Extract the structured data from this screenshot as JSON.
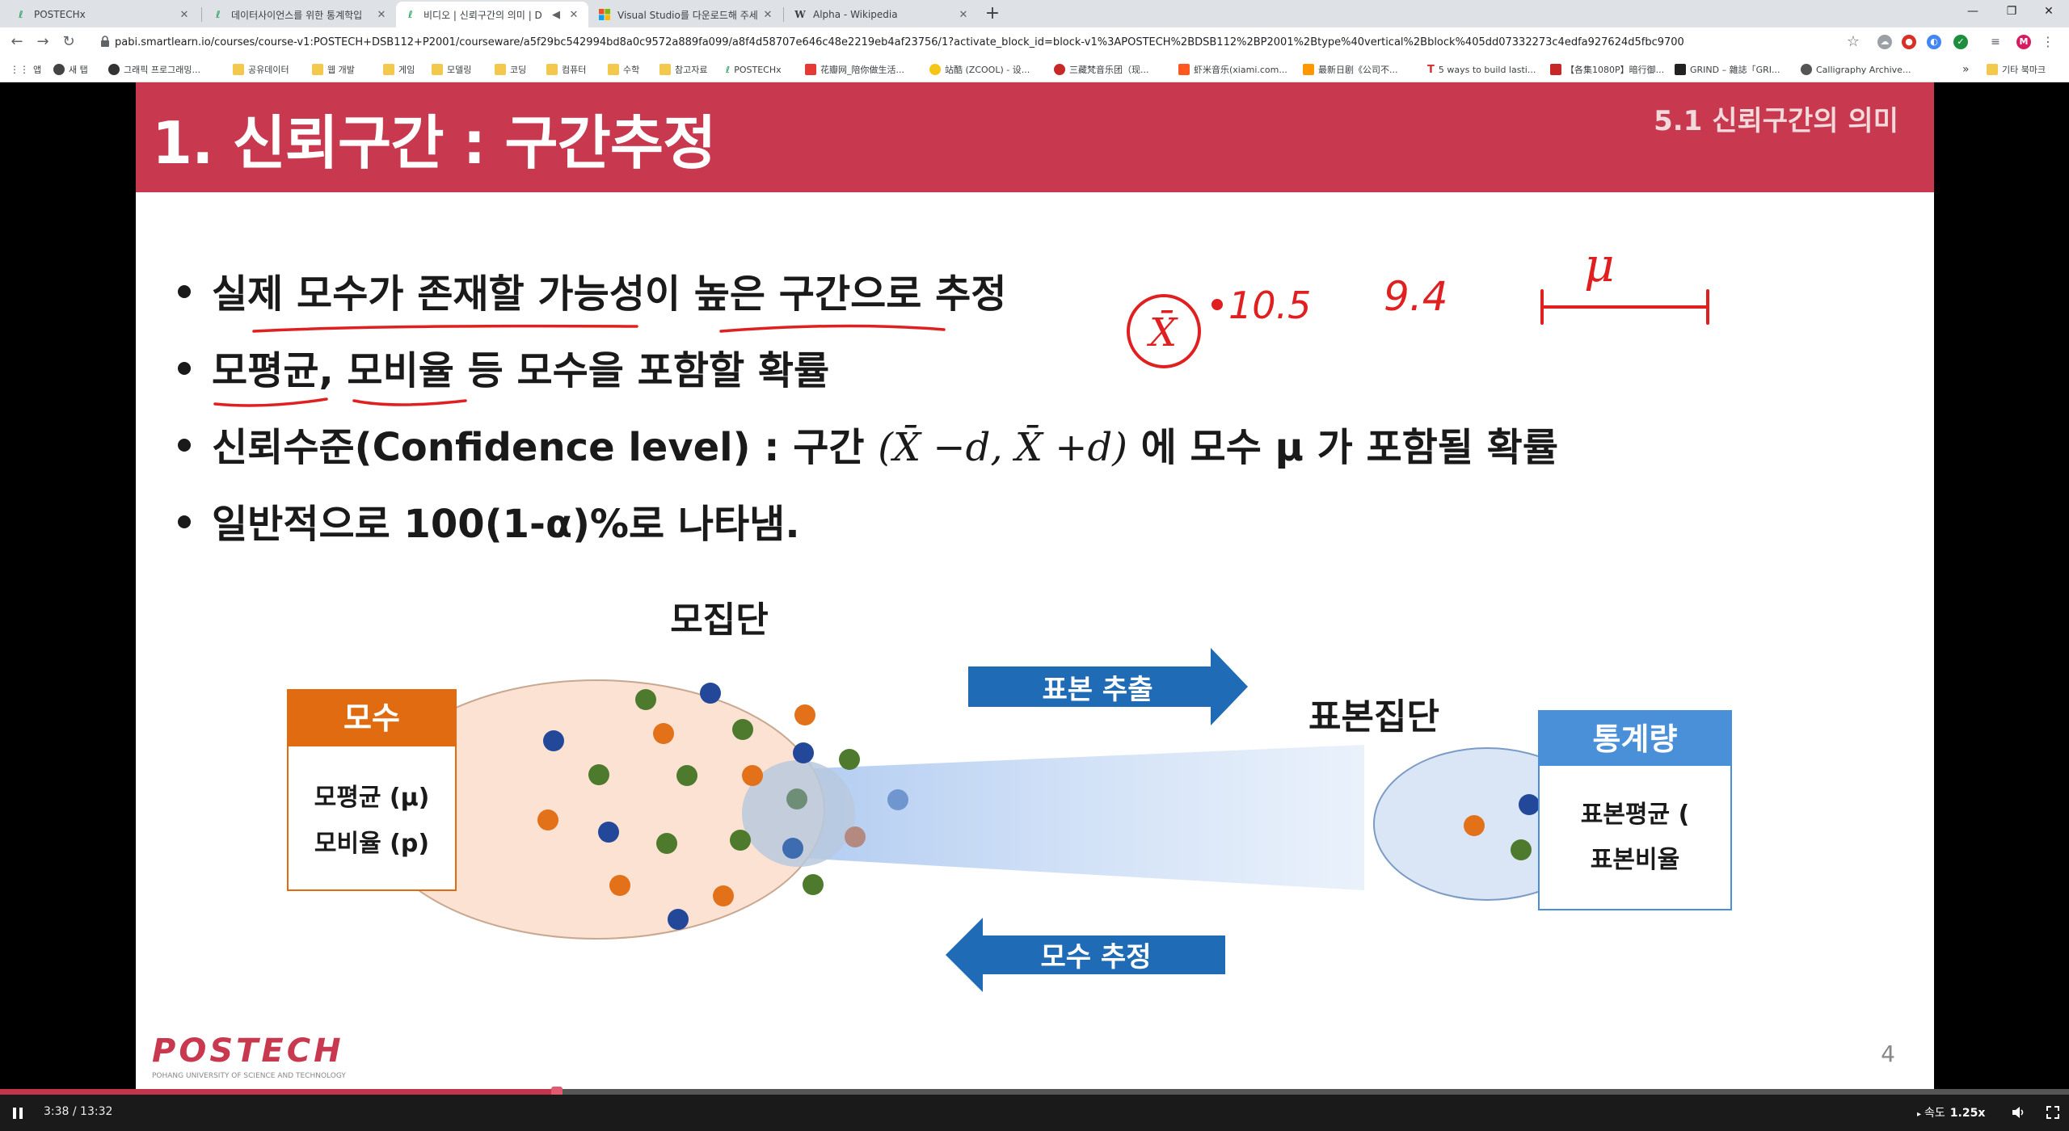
{
  "browser": {
    "tabs": [
      {
        "title": "POSTECHx",
        "icon": "edx-icon",
        "active": false
      },
      {
        "title": "데이터사이언스를 위한 통계학입",
        "icon": "edx-icon",
        "active": false
      },
      {
        "title": "비디오 | 신뢰구간의 의미 | D",
        "icon": "edx-icon",
        "active": true
      },
      {
        "title": "Visual Studio를 다운로드해 주세",
        "icon": "microsoft-icon",
        "active": false
      },
      {
        "title": "Alpha - Wikipedia",
        "icon": "wikipedia-icon",
        "active": false
      }
    ],
    "url": "pabi.smartlearn.io/courses/course-v1:POSTECH+DSB112+P2001/courseware/a5f29bc542994bd8a0c9572a889fa099/a8f4d58707e646c48e2219eb4af23756/1?activate_block_id=block-v1%3APOSTECH%2BDSB112%2BP2001%2Btype%40vertical%2Bblock%405dd07332273c4edfa927624d5fbc9700",
    "profile_initial": "M",
    "bookmarks": [
      {
        "label": "앱",
        "type": "apps"
      },
      {
        "label": "새 탭",
        "type": "site"
      },
      {
        "label": "그래픽 프로그래밍...",
        "type": "site"
      },
      {
        "label": "공유데이터",
        "type": "folder"
      },
      {
        "label": "웹 개발",
        "type": "folder"
      },
      {
        "label": "게임",
        "type": "folder"
      },
      {
        "label": "모델링",
        "type": "folder"
      },
      {
        "label": "코딩",
        "type": "folder"
      },
      {
        "label": "컴퓨터",
        "type": "folder"
      },
      {
        "label": "수학",
        "type": "folder"
      },
      {
        "label": "참고자료",
        "type": "folder"
      },
      {
        "label": "POSTECHx",
        "type": "site"
      },
      {
        "label": "花瓣网_陪你做生活...",
        "type": "site"
      },
      {
        "label": "站酷 (ZCOOL) - 设...",
        "type": "site"
      },
      {
        "label": "三藏梵音乐团（现...",
        "type": "site"
      },
      {
        "label": "虾米音乐(xiami.com...",
        "type": "site"
      },
      {
        "label": "最新日剧《公司不...",
        "type": "site"
      },
      {
        "label": "5 ways to build lasti...",
        "type": "site"
      },
      {
        "label": "【各集1080P】暗行御...",
        "type": "site"
      },
      {
        "label": "GRIND – 雜誌「GRI...",
        "type": "site"
      },
      {
        "label": "Calligraphy Archive...",
        "type": "site"
      },
      {
        "label": "»",
        "type": "more"
      },
      {
        "label": "기타 북마크",
        "type": "folder"
      }
    ]
  },
  "slide": {
    "title": "1. 신뢰구간 : 구간추정",
    "section": "5.1 신뢰구간의 의미",
    "bullets": [
      "실제 모수가 존재할 가능성이 높은 구간으로 추정",
      "모평균, 모비율 등 모수을 포함할 확률",
      "신뢰수준(Confidence level) : 구간",
      "일반적으로 100(1-α)%로 나타냄."
    ],
    "bullet3_formula": "(X̄ −d, X̄ +d)",
    "bullet3_suffix": "에 모수 μ 가 포함될 확률",
    "annotations": {
      "circled": "X̄",
      "v1": "10.5",
      "v2": "9.4",
      "mu": "μ"
    },
    "population_label": "모집단",
    "sample_label": "표본집단",
    "arrow_sampling": "표본 추출",
    "arrow_estimation": "모수 추정",
    "parameter_box": {
      "header": "모수",
      "line1": "모평균 (μ)",
      "line2": "모비율 (p)"
    },
    "statistic_box": {
      "header": "통계량",
      "line1": "표본평균 (",
      "line2": "표본비율"
    },
    "logo": "POSTECH",
    "logo_sub": "POHANG UNIVERSITY OF SCIENCE AND TECHNOLOGY",
    "page_number": "4",
    "colors": {
      "header": "#c8384e",
      "parameter": "#e06b10",
      "statistic": "#4a90d9",
      "arrow": "#1f6bb5"
    }
  },
  "player": {
    "time": "3:38 / 13:32",
    "progress": 0.269,
    "speed_label": "속도",
    "speed_value": "1.25x"
  }
}
